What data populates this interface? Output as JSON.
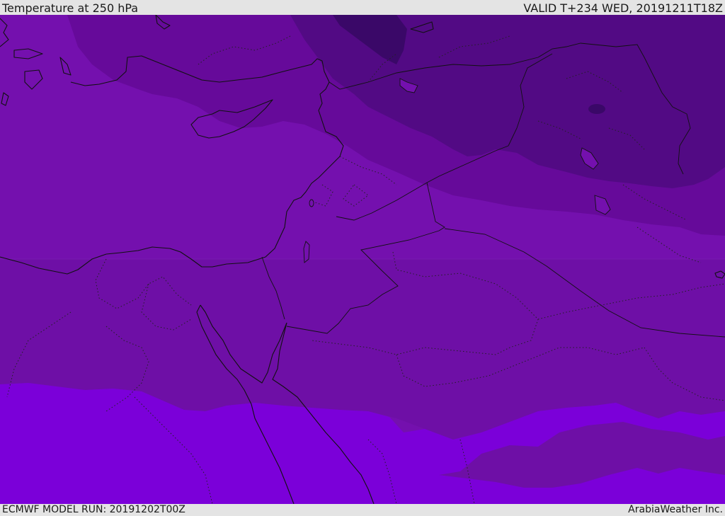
{
  "header": {
    "title": "Temperature at 250 hPa",
    "valid": "VALID T+234 WED, 20191211T18Z"
  },
  "footer": {
    "model_run": "ECMWF MODEL RUN: 20191202T00Z",
    "credit": "ArabiaWeather Inc."
  },
  "map": {
    "colors": {
      "band_darkest": "#3a0868",
      "band_dark": "#520a84",
      "band_mid_dark": "#660a9a",
      "band_mid": "#7410ae",
      "band_mid_low": "#6e0fa6",
      "band_light": "#7b00d9",
      "lake_fill": "#7410ae"
    }
  }
}
